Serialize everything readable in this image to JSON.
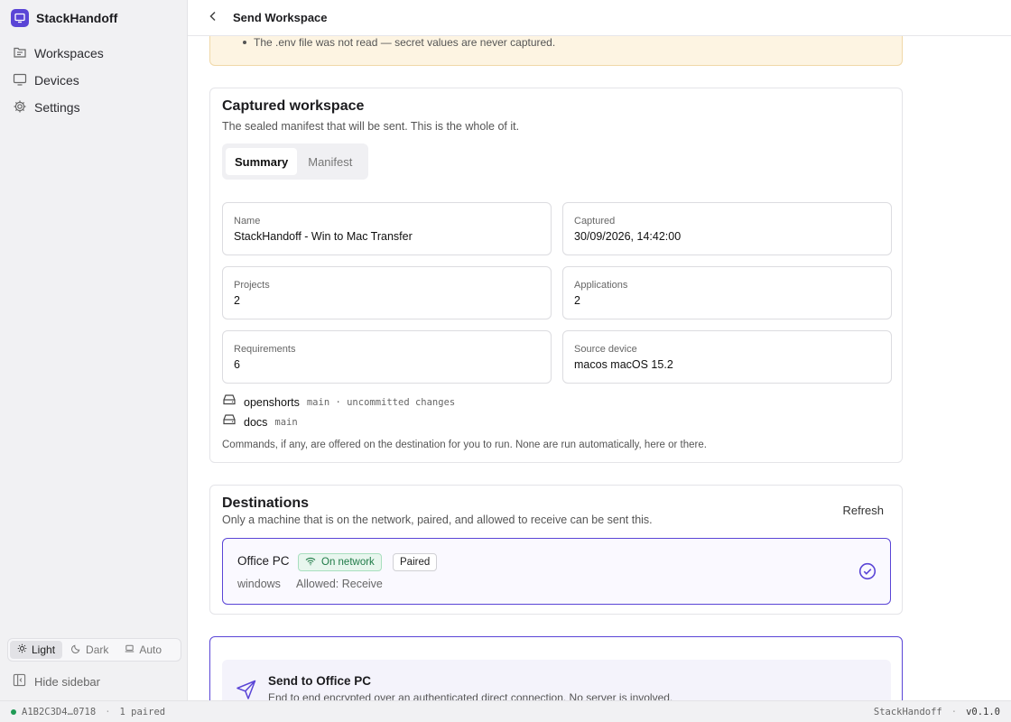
{
  "app": {
    "name": "StackHandoff",
    "accent": "#5a45d6"
  },
  "sidebar": {
    "items": [
      {
        "label": "Workspaces",
        "icon": "folder-tree-icon"
      },
      {
        "label": "Devices",
        "icon": "monitor-icon"
      },
      {
        "label": "Settings",
        "icon": "gear-icon"
      }
    ],
    "theme": {
      "options": [
        "Light",
        "Dark",
        "Auto"
      ],
      "selected": "Light"
    },
    "hide_label": "Hide sidebar"
  },
  "header": {
    "title": "Send Workspace"
  },
  "notice": {
    "text": "The .env file was not read — secret values are never captured."
  },
  "captured": {
    "title": "Captured workspace",
    "subtitle": "The sealed manifest that will be sent. This is the whole of it.",
    "tabs": [
      "Summary",
      "Manifest"
    ],
    "active_tab": "Summary",
    "fields": [
      {
        "label": "Name",
        "value": "StackHandoff - Win to Mac Transfer"
      },
      {
        "label": "Captured",
        "value": "30/09/2026, 14:42:00"
      },
      {
        "label": "Projects",
        "value": "2"
      },
      {
        "label": "Applications",
        "value": "2"
      },
      {
        "label": "Requirements",
        "value": "6"
      },
      {
        "label": "Source device",
        "value": "macos macOS 15.2"
      }
    ],
    "repos": [
      {
        "name": "openshorts",
        "meta": "main · uncommitted changes"
      },
      {
        "name": "docs",
        "meta": "main"
      }
    ],
    "footnote": "Commands, if any, are offered on the destination for you to run. None are run automatically, here or there."
  },
  "destinations": {
    "title": "Destinations",
    "subtitle": "Only a machine that is on the network, paired, and allowed to receive can be sent this.",
    "refresh_label": "Refresh",
    "items": [
      {
        "name": "Office PC",
        "network_badge": "On network",
        "paired_badge": "Paired",
        "os": "windows",
        "allowed": "Allowed: Receive",
        "selected": true
      }
    ]
  },
  "send": {
    "title": "Send to Office PC",
    "subtitle": "End to end encrypted over an authenticated direct connection. No server is involved."
  },
  "statusbar": {
    "device_id": "A1B2C3D4…0718",
    "paired": "1 paired",
    "app_name": "StackHandoff",
    "version": "v0.1.0"
  }
}
